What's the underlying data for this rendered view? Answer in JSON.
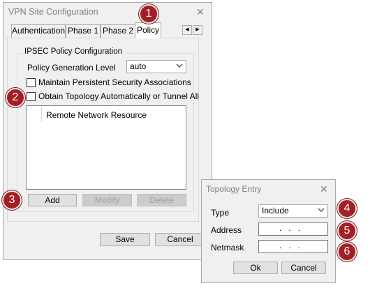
{
  "main_window": {
    "title": "VPN Site Configuration",
    "tabs": [
      "Authentication",
      "Phase 1",
      "Phase 2",
      "Policy"
    ],
    "active_tab": "Policy",
    "group_title": "IPSEC Policy Configuration",
    "policy_level_label": "Policy Generation Level",
    "policy_level_value": "auto",
    "maintain_sa_label": "Maintain Persistent Security Associations",
    "obtain_topology_label": "Obtain Topology Automatically or Tunnel All",
    "list_header": "Remote Network Resource",
    "buttons": {
      "add": "Add",
      "modify": "Modify",
      "delete": "Delete",
      "save": "Save",
      "cancel": "Cancel"
    }
  },
  "topology_dialog": {
    "title": "Topology Entry",
    "type_label": "Type",
    "type_value": "Include",
    "address_label": "Address",
    "address_value": "...",
    "netmask_label": "Netmask",
    "netmask_value": "...",
    "buttons": {
      "ok": "Ok",
      "cancel": "Cancel"
    }
  },
  "callouts": [
    "1",
    "2",
    "3",
    "4",
    "5",
    "6"
  ],
  "icons": {
    "close": "close-icon",
    "chevron_down": "chevron-down-icon",
    "arrow_left": "arrow-left-icon",
    "arrow_right": "arrow-right-icon"
  },
  "colors": {
    "badge": "#a31f24",
    "window_bg": "#f0f0f0",
    "disabled_text": "#a0a0a0"
  }
}
